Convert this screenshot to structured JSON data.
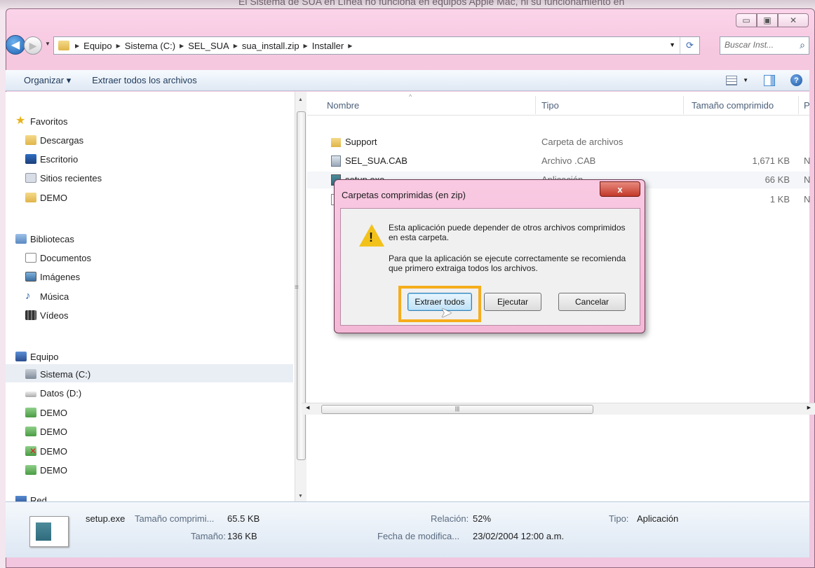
{
  "window": {
    "background_title": "El Sistema de SUA en Línea no funciona en equipos Apple Mac, ni su funcionamiento en",
    "controls": [
      "minimize",
      "maximize",
      "close"
    ]
  },
  "address_bar": {
    "crumbs": [
      "Equipo",
      "Sistema (C:)",
      "SEL_SUA",
      "sua_install.zip",
      "Installer"
    ],
    "search_placeholder": "Buscar Inst...",
    "search_icon": "magnifier-icon",
    "refresh_icon": "refresh-icon"
  },
  "toolbar": {
    "organize_label": "Organizar ▾",
    "extract_all_label": "Extraer todos los archivos",
    "view_icon": "view-options-icon",
    "preview_icon": "preview-pane-icon",
    "help_icon": "help-icon"
  },
  "nav": {
    "favorites": "Favoritos",
    "descargas": "Descargas",
    "escritorio": "Escritorio",
    "sitios": "Sitios recientes",
    "demo_fav": "DEMO",
    "bibliotecas": "Bibliotecas",
    "documentos": "Documentos",
    "imagenes": "Imágenes",
    "musica": "Música",
    "videos": "Vídeos",
    "equipo": "Equipo",
    "sistema": "Sistema (C:)",
    "datos": "Datos (D:)",
    "demo1": "DEMO",
    "demo2": "DEMO",
    "demo3": "DEMO",
    "demo4": "DEMO",
    "red": "Red"
  },
  "files": {
    "headers": {
      "name": "Nombre",
      "type": "Tipo",
      "size": "Tamaño comprimido",
      "extra": "P"
    },
    "rows": [
      {
        "name": "Support",
        "type": "Carpeta de archivos",
        "size": "",
        "extra": ""
      },
      {
        "name": "SEL_SUA.CAB",
        "type": "Archivo .CAB",
        "size": "1,671 KB",
        "extra": "N"
      },
      {
        "name": "setup.exe",
        "type": "Aplicación",
        "size": "66 KB",
        "extra": "N"
      },
      {
        "name": "",
        "type": "",
        "size": "1 KB",
        "extra": "N"
      }
    ]
  },
  "details": {
    "filename": "setup.exe",
    "compressed_label": "Tamaño comprimi...",
    "compressed_value": "65.5 KB",
    "size_label": "Tamaño:",
    "size_value": "136 KB",
    "ratio_label": "Relación:",
    "ratio_value": "52%",
    "modified_label": "Fecha de modifica...",
    "modified_value": "23/02/2004 12:00 a.m.",
    "type_label": "Tipo:",
    "type_value": "Aplicación"
  },
  "dialog": {
    "title": "Carpetas comprimidas (en zip)",
    "close_label": "x",
    "line1": "Esta aplicación puede depender de otros archivos comprimidos en esta carpeta.",
    "line2": "Para que la aplicación se ejecute correctamente se recomienda que primero extraiga todos los archivos.",
    "btn_extract": "Extraer todos",
    "btn_run": "Ejecutar",
    "btn_cancel": "Cancelar"
  },
  "colors": {
    "window_frame": "#f2c6de",
    "highlight": "#f6ad1c",
    "close_button": "#c3392a"
  }
}
